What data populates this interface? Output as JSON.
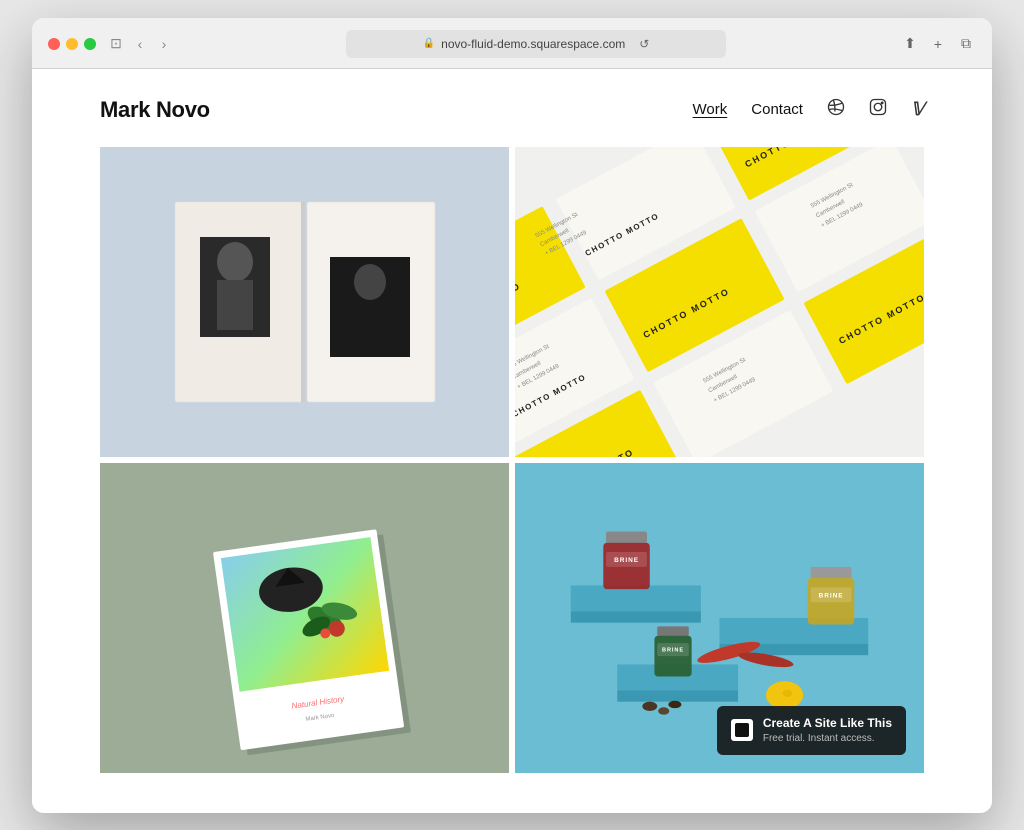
{
  "browser": {
    "url": "novo-fluid-demo.squarespace.com",
    "back_label": "‹",
    "forward_label": "›",
    "refresh_label": "↺",
    "share_label": "⬆",
    "new_tab_label": "+",
    "copy_label": "⧉"
  },
  "site": {
    "title": "Mark Novo",
    "nav": {
      "work_label": "Work",
      "contact_label": "Contact",
      "dribbble_label": "⊛",
      "instagram_label": "◻",
      "vimeo_label": "𝕍"
    }
  },
  "portfolio": {
    "items": [
      {
        "id": "book-bw",
        "alt": "Open book with black and white portrait photographs"
      },
      {
        "id": "business-cards",
        "alt": "Yellow and white business cards for Chotto Motto brand"
      },
      {
        "id": "book-colorful",
        "alt": "Colorful book with bird and botanical illustration cover"
      },
      {
        "id": "brine-jars",
        "alt": "Brine branded pickle jar products on blue platforms"
      }
    ]
  },
  "squarespace_banner": {
    "title": "Create A Site Like This",
    "subtitle": "Free trial. Instant access."
  }
}
